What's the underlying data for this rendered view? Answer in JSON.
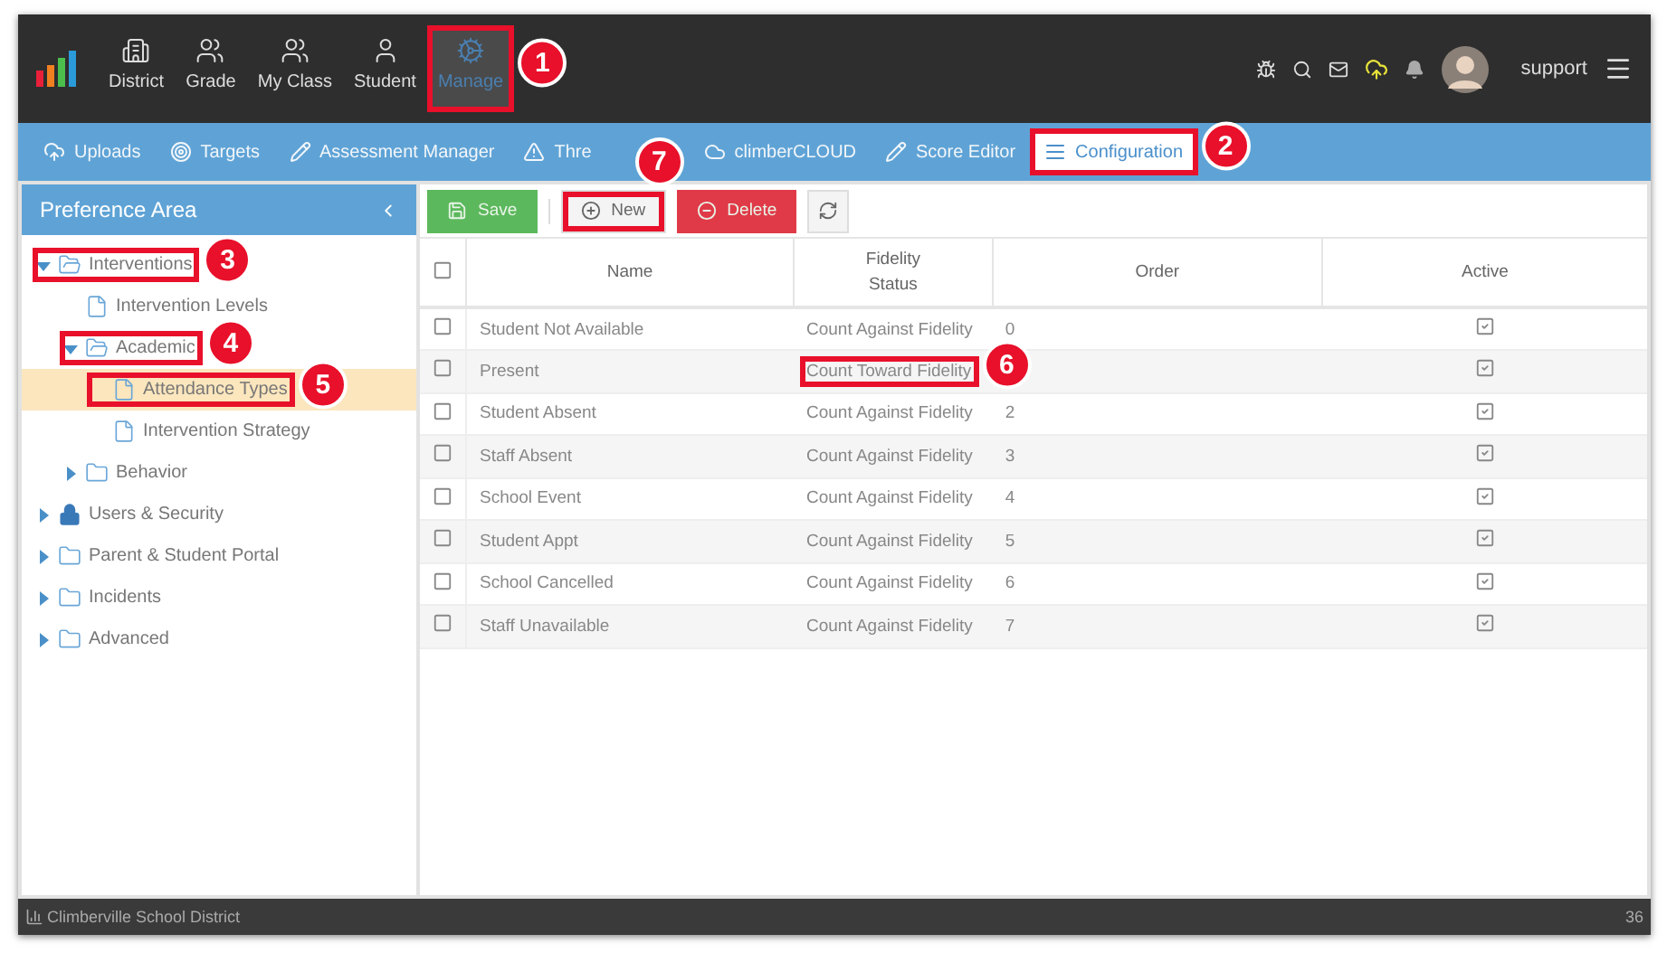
{
  "top_nav": {
    "items": [
      {
        "label": "District",
        "selected": false
      },
      {
        "label": "Grade",
        "selected": false
      },
      {
        "label": "My Class",
        "selected": false
      },
      {
        "label": "Student",
        "selected": false
      },
      {
        "label": "Manage",
        "selected": true,
        "callout": "1"
      }
    ],
    "user": {
      "name": "support"
    }
  },
  "sub_nav": {
    "tabs": [
      {
        "label": "Uploads",
        "selected": false
      },
      {
        "label": "Targets",
        "selected": false
      },
      {
        "label": "Assessment Manager",
        "selected": false
      },
      {
        "label": "Thre",
        "selected": false
      },
      {
        "label": "climberCLOUD",
        "selected": false
      },
      {
        "label": "Score Editor",
        "selected": false
      },
      {
        "label": "Configuration",
        "selected": true,
        "callout": "2"
      }
    ]
  },
  "sidebar": {
    "title": "Preference Area",
    "items": [
      {
        "label": "Interventions",
        "kind": "folder",
        "expanded": true,
        "selected": false,
        "callout": "3",
        "children": [
          {
            "label": "Intervention Levels",
            "kind": "page",
            "selected": false
          },
          {
            "label": "Academic",
            "kind": "folder",
            "expanded": true,
            "selected": false,
            "callout": "4",
            "children": [
              {
                "label": "Attendance Types",
                "kind": "page",
                "selected": true,
                "callout": "5"
              },
              {
                "label": "Intervention Strategy",
                "kind": "page",
                "selected": false
              }
            ]
          },
          {
            "label": "Behavior",
            "kind": "folder",
            "expanded": false,
            "selected": false
          }
        ]
      },
      {
        "label": "Users & Security",
        "kind": "locked",
        "expanded": false,
        "selected": false
      },
      {
        "label": "Parent & Student Portal",
        "kind": "folder",
        "expanded": false,
        "selected": false
      },
      {
        "label": "Incidents",
        "kind": "folder",
        "expanded": false,
        "selected": false
      },
      {
        "label": "Advanced",
        "kind": "folder",
        "expanded": false,
        "selected": false
      }
    ]
  },
  "toolbar": {
    "buttons": [
      {
        "kind": "save",
        "label": "Save"
      },
      {
        "kind": "new",
        "label": "New",
        "callout": "7"
      },
      {
        "kind": "delete",
        "label": "Delete"
      },
      {
        "kind": "refresh"
      }
    ]
  },
  "table": {
    "select_all_checked": false,
    "columns": [
      "Name",
      "Fidelity Status",
      "Order",
      "Active"
    ],
    "rows": [
      {
        "checked": false,
        "name": "Student Not Available",
        "fidelity": "Count Against Fidelity",
        "order": "0",
        "active": true
      },
      {
        "checked": false,
        "name": "Present",
        "fidelity": "Count Toward Fidelity",
        "fidelity_callout": "6",
        "order": "",
        "active": true
      },
      {
        "checked": false,
        "name": "Student Absent",
        "fidelity": "Count Against Fidelity",
        "order": "2",
        "active": true
      },
      {
        "checked": false,
        "name": "Staff Absent",
        "fidelity": "Count Against Fidelity",
        "order": "3",
        "active": true
      },
      {
        "checked": false,
        "name": "School Event",
        "fidelity": "Count Against Fidelity",
        "order": "4",
        "active": true
      },
      {
        "checked": false,
        "name": "Student Appt",
        "fidelity": "Count Against Fidelity",
        "order": "5",
        "active": true
      },
      {
        "checked": false,
        "name": "School Cancelled",
        "fidelity": "Count Against Fidelity",
        "order": "6",
        "active": true
      },
      {
        "checked": false,
        "name": "Staff Unavailable",
        "fidelity": "Count Against Fidelity",
        "order": "7",
        "active": true
      }
    ]
  },
  "footer": {
    "text": "Climberville School District",
    "page": "36"
  }
}
